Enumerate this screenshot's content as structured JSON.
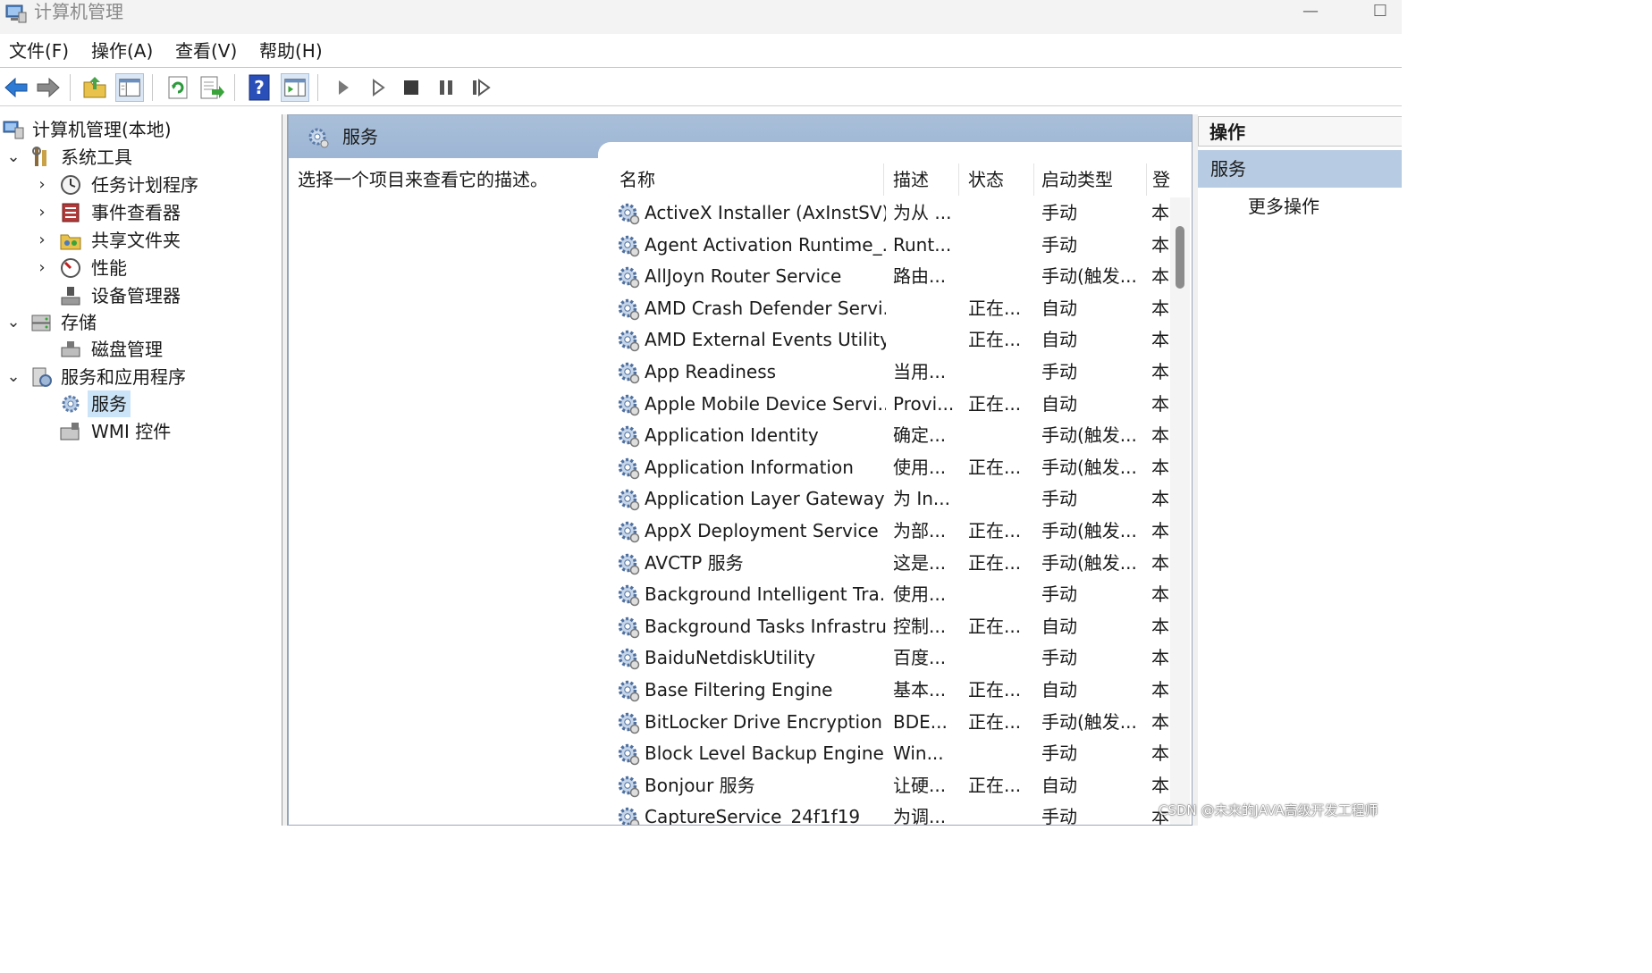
{
  "window": {
    "title": "计算机管理"
  },
  "menu": [
    "文件(F)",
    "操作(A)",
    "查看(V)",
    "帮助(H)"
  ],
  "tree": {
    "root": "计算机管理(本地)",
    "system_tools": "系统工具",
    "task_scheduler": "任务计划程序",
    "event_viewer": "事件查看器",
    "shared_folders": "共享文件夹",
    "performance": "性能",
    "device_manager": "设备管理器",
    "storage": "存储",
    "disk_management": "磁盘管理",
    "services_apps": "服务和应用程序",
    "services": "服务",
    "wmi": "WMI 控件"
  },
  "center": {
    "header_title": "服务",
    "description": "选择一个项目来查看它的描述。",
    "columns": {
      "name": "名称",
      "desc": "描述",
      "status": "状态",
      "startup": "启动类型",
      "logon": "登"
    },
    "services": [
      {
        "name": "ActiveX Installer (AxInstSV)",
        "desc": "为从 ...",
        "status": "",
        "startup": "手动",
        "logon": "本"
      },
      {
        "name": "Agent Activation Runtime_...",
        "desc": "Runt...",
        "status": "",
        "startup": "手动",
        "logon": "本"
      },
      {
        "name": "AllJoyn Router Service",
        "desc": "路由...",
        "status": "",
        "startup": "手动(触发...",
        "logon": "本"
      },
      {
        "name": "AMD Crash Defender Servi...",
        "desc": "",
        "status": "正在...",
        "startup": "自动",
        "logon": "本"
      },
      {
        "name": "AMD External Events Utility",
        "desc": "",
        "status": "正在...",
        "startup": "自动",
        "logon": "本"
      },
      {
        "name": "App Readiness",
        "desc": "当用...",
        "status": "",
        "startup": "手动",
        "logon": "本"
      },
      {
        "name": "Apple Mobile Device Servi...",
        "desc": "Provi...",
        "status": "正在...",
        "startup": "自动",
        "logon": "本"
      },
      {
        "name": "Application Identity",
        "desc": "确定...",
        "status": "",
        "startup": "手动(触发...",
        "logon": "本"
      },
      {
        "name": "Application Information",
        "desc": "使用...",
        "status": "正在...",
        "startup": "手动(触发...",
        "logon": "本"
      },
      {
        "name": "Application Layer Gateway ...",
        "desc": "为 In...",
        "status": "",
        "startup": "手动",
        "logon": "本"
      },
      {
        "name": "AppX Deployment Service ...",
        "desc": "为部...",
        "status": "正在...",
        "startup": "手动(触发...",
        "logon": "本"
      },
      {
        "name": "AVCTP 服务",
        "desc": "这是...",
        "status": "正在...",
        "startup": "手动(触发...",
        "logon": "本"
      },
      {
        "name": "Background Intelligent Tra...",
        "desc": "使用...",
        "status": "",
        "startup": "手动",
        "logon": "本"
      },
      {
        "name": "Background Tasks Infrastru...",
        "desc": "控制...",
        "status": "正在...",
        "startup": "自动",
        "logon": "本"
      },
      {
        "name": "BaiduNetdiskUtility",
        "desc": "百度...",
        "status": "",
        "startup": "手动",
        "logon": "本"
      },
      {
        "name": "Base Filtering Engine",
        "desc": "基本...",
        "status": "正在...",
        "startup": "自动",
        "logon": "本"
      },
      {
        "name": "BitLocker Drive Encryption ...",
        "desc": "BDE...",
        "status": "正在...",
        "startup": "手动(触发...",
        "logon": "本"
      },
      {
        "name": "Block Level Backup Engine ...",
        "desc": "Win...",
        "status": "",
        "startup": "手动",
        "logon": "本"
      },
      {
        "name": "Bonjour 服务",
        "desc": "让硬...",
        "status": "正在...",
        "startup": "自动",
        "logon": "本"
      },
      {
        "name": "CaptureService_24f1f19",
        "desc": "为调...",
        "status": "",
        "startup": "手动",
        "logon": "本"
      }
    ]
  },
  "actions": {
    "title": "操作",
    "services": "服务",
    "more": "更多操作"
  },
  "watermark": "CSDN @未来的JAVA高级开发工程师"
}
